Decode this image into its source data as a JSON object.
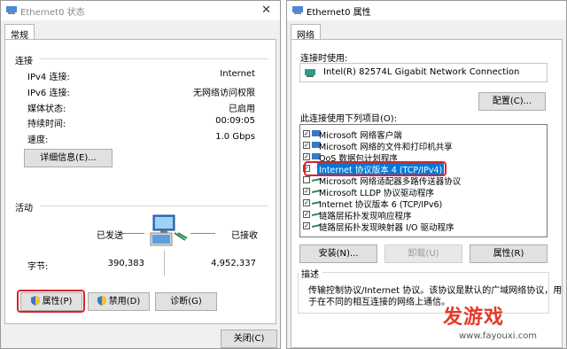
{
  "left": {
    "title": "Ethernet0 状态",
    "tab": "常规",
    "connection": {
      "section": "连接",
      "rows": [
        {
          "label": "IPv4 连接:",
          "value": "Internet"
        },
        {
          "label": "IPv6 连接:",
          "value": "无网络访问权限"
        },
        {
          "label": "媒体状态:",
          "value": "已启用"
        },
        {
          "label": "持续时间:",
          "value": "00:09:05"
        },
        {
          "label": "速度:",
          "value": "1.0 Gbps"
        }
      ],
      "details_button": "详细信息(E)..."
    },
    "activity": {
      "section": "活动",
      "sent_label": "已发送",
      "received_label": "已接收",
      "bytes_label": "字节:",
      "sent_value": "390,383",
      "received_value": "4,952,337"
    },
    "buttons": {
      "properties": "属性(P)",
      "disable": "禁用(D)",
      "diagnose": "诊断(G)"
    },
    "close_button": "关闭(C)"
  },
  "right": {
    "title": "Ethernet0 属性",
    "tab": "网络",
    "connect_using_label": "连接时使用:",
    "adapter": "Intel(R) 82574L Gigabit Network Connection",
    "configure_button": "配置(C)...",
    "items_label": "此连接使用下列项目(O):",
    "items": [
      {
        "label": "Microsoft 网络客户端"
      },
      {
        "label": "Microsoft 网络的文件和打印机共享"
      },
      {
        "label": "QoS 数据包计划程序"
      },
      {
        "label": "Internet 协议版本 4 (TCP/IPv4)"
      },
      {
        "label": "Microsoft 网络适配器多路传送器协议"
      },
      {
        "label": "Microsoft LLDP 协议驱动程序"
      },
      {
        "label": "Internet 协议版本 6 (TCP/IPv6)"
      },
      {
        "label": "链路层拓扑发现响应程序"
      },
      {
        "label": "链路层拓扑发现映射器 I/O 驱动程序"
      }
    ],
    "install_button": "安装(N)...",
    "uninstall_button": "卸载(U)",
    "properties_button": "属性(R)",
    "description": {
      "title": "描述",
      "text_line1": "传输控制协议/Internet 协议。该协议是默认的广域网络协议，用",
      "text_line2": "于在不同的相互连接的网络上通信。"
    }
  },
  "watermark": {
    "logo": "发游戏",
    "url": "www.fayouxi.com"
  },
  "colors": {
    "highlight_box": "#d8232a",
    "selection": "#0078d7",
    "watermark": "#e53a2b"
  }
}
